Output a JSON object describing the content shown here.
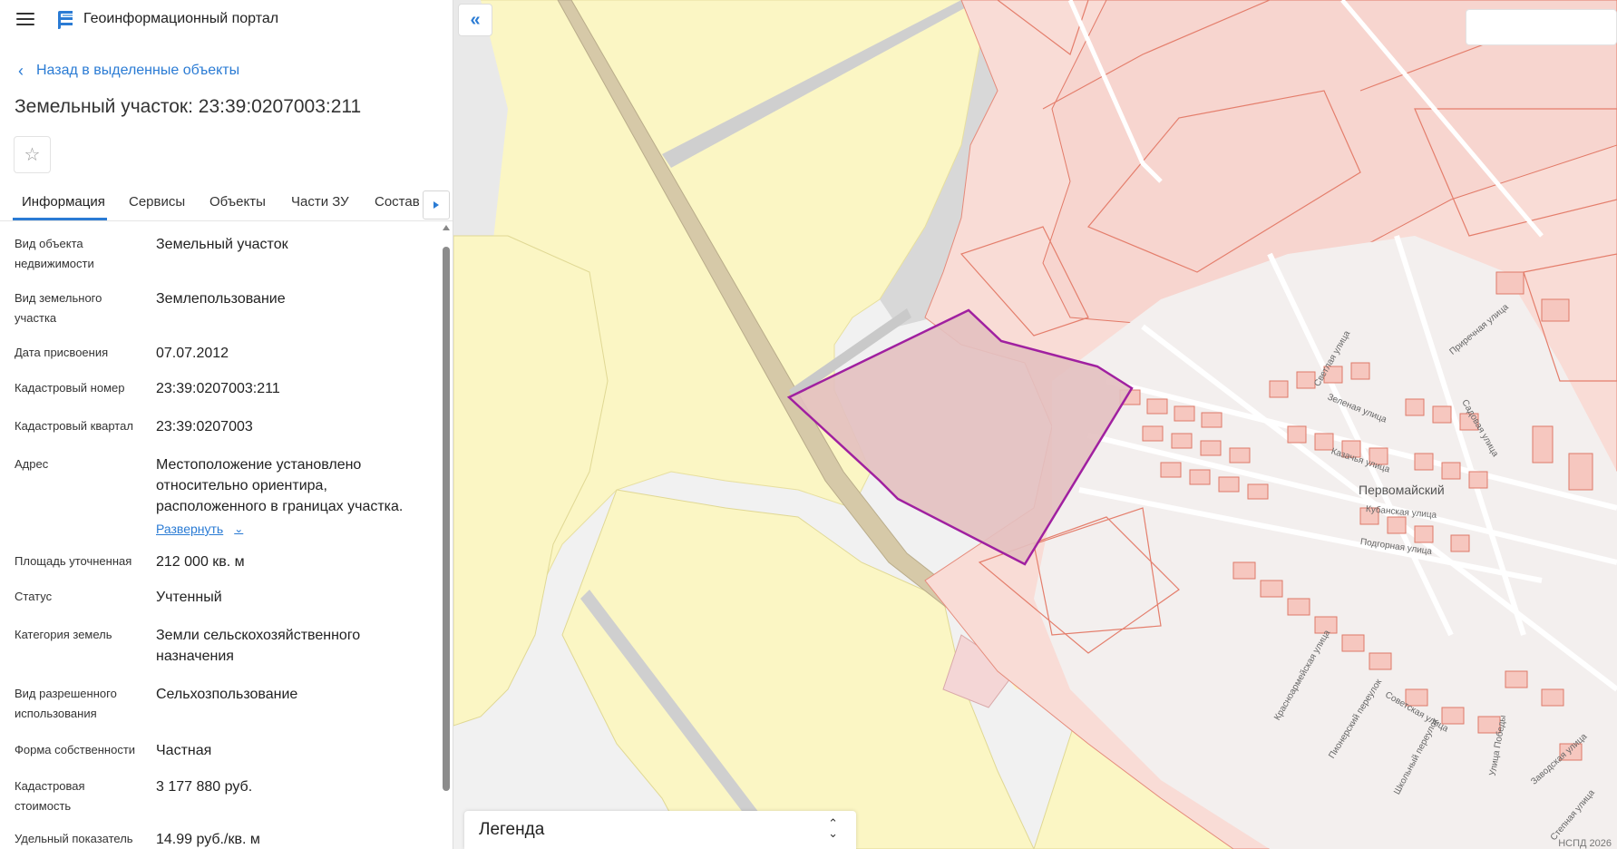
{
  "app": {
    "title": "Геоинформационный портал"
  },
  "nav": {
    "back_label": "Назад в выделенные объекты"
  },
  "object": {
    "title": "Земельный участок: 23:39:0207003:211"
  },
  "tabs": [
    {
      "label": "Информация",
      "active": true
    },
    {
      "label": "Сервисы"
    },
    {
      "label": "Объекты"
    },
    {
      "label": "Части ЗУ"
    },
    {
      "label": "Состав"
    }
  ],
  "properties": [
    {
      "label": "Вид объекта недвижимости",
      "value": "Земельный участок"
    },
    {
      "label": "Вид земельного участка",
      "value": "Землепользование"
    },
    {
      "label": "Дата присвоения",
      "value": "07.07.2012"
    },
    {
      "label": "Кадастровый номер",
      "value": "23:39:0207003:211"
    },
    {
      "label": "Кадастровый квартал",
      "value": "23:39:0207003"
    },
    {
      "label": "Адрес",
      "value": "Местоположение установлено относительно ориентира, расположенного в границах участка.",
      "expand_label": "Развернуть"
    },
    {
      "label": "Площадь уточненная",
      "value": "212 000 кв. м"
    },
    {
      "label": "Статус",
      "value": "Учтенный"
    },
    {
      "label": "Категория земель",
      "value": "Земли сельскохозяйственного назначения"
    },
    {
      "label": "Вид разрешенного использования",
      "value": "Сельхозпользование"
    },
    {
      "label": "Форма собственности",
      "value": "Частная"
    },
    {
      "label": "Кадастровая стоимость",
      "value": "3 177 880 руб."
    },
    {
      "label": "Удельный показатель",
      "value": "14.99 руб./кв. м"
    }
  ],
  "map": {
    "legend_title": "Легенда",
    "settlement_label": "Первомайский",
    "copyright": "НСПД 2026",
    "streets": [
      "Светлая улица",
      "Зеленая улица",
      "Казачья улица",
      "Кубанская улица",
      "Подгорная улица",
      "Садовая улица",
      "Приречная улица",
      "Красноармейская улица",
      "Пионерский переулок",
      "Советская улица",
      "Школьный переулок",
      "Улица Победы",
      "Заводская улица",
      "Степная улица"
    ]
  },
  "colors": {
    "accent": "#2a7bd4",
    "selected_parcel_stroke": "#a020a0",
    "selected_parcel_fill": "#e3c0c0",
    "agri_fill": "#fbf6c4",
    "urban_fill": "#f9dcd6",
    "urban_stroke": "#e58a7a"
  },
  "icons": {
    "menu": "menu-icon",
    "logo": "portal-logo-icon",
    "back": "chevron-left-icon",
    "favorite": "star-icon",
    "tabs_next": "caret-right-icon",
    "collapse": "double-chevron-left-icon",
    "legend_toggle": "unfold-icon",
    "expand": "chevron-down-icon"
  }
}
